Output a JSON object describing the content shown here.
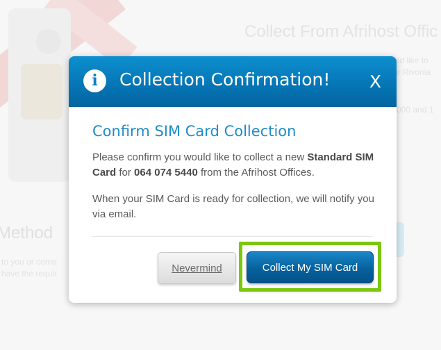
{
  "background": {
    "heading": "Collect From Afrihost Offic",
    "side_lines": [
      "uld like to",
      "ur Rivonia",
      "000 and 1"
    ],
    "method_heading": "Method",
    "method_lines": [
      "to you or come",
      "have the requir"
    ]
  },
  "modal": {
    "title": "Collection Confirmation!",
    "info_icon": "i",
    "close_label": "X",
    "subtitle": "Confirm SIM Card Collection",
    "paragraph1": {
      "prefix": "Please confirm you would like to collect a new ",
      "sim_type": "Standard SIM Card",
      "middle": " for ",
      "number": "064 074 5440",
      "suffix": " from the Afrihost Offices."
    },
    "paragraph2": "When your SIM Card is ready for collection, we will notify you via email.",
    "buttons": {
      "cancel": "Nevermind",
      "confirm": "Collect My SIM Card"
    }
  },
  "colors": {
    "header_blue": "#0574b4",
    "subtitle_blue": "#1e8cc8",
    "highlight_green": "#7ac70c"
  }
}
